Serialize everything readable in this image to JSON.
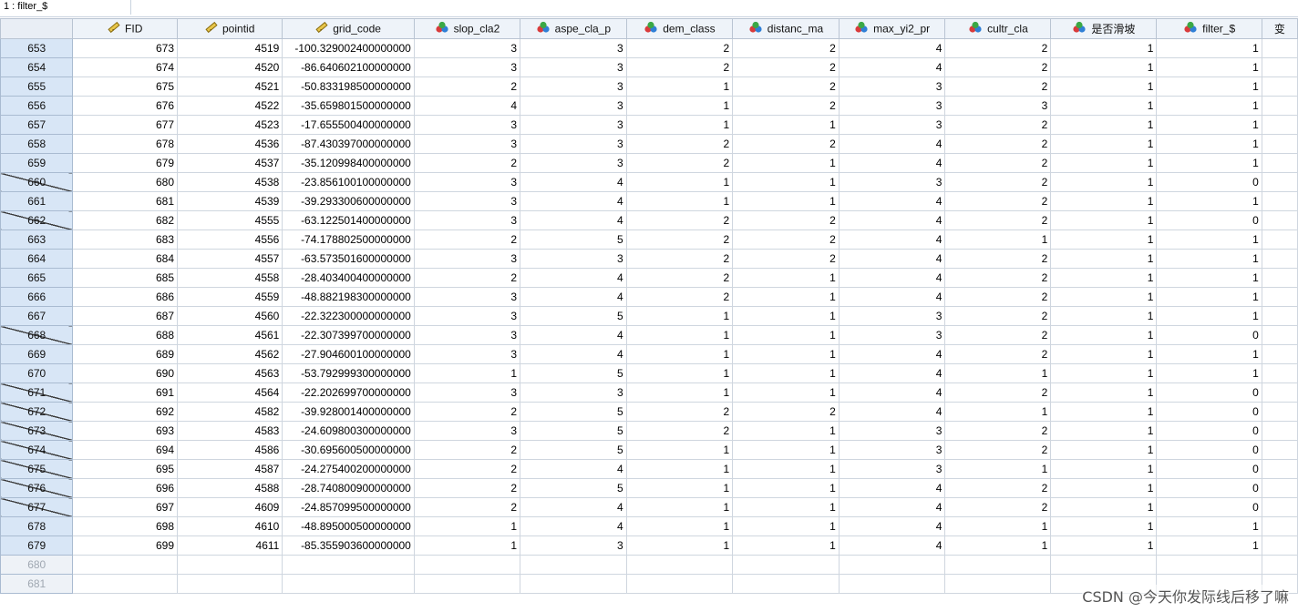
{
  "cell_reference": "1 : filter_$",
  "columns": [
    {
      "name": "FID",
      "icon": "ruler-icon"
    },
    {
      "name": "pointid",
      "icon": "ruler-icon"
    },
    {
      "name": "grid_code",
      "icon": "ruler-icon"
    },
    {
      "name": "slop_cla2",
      "icon": "nominal-icon"
    },
    {
      "name": "aspe_cla_p",
      "icon": "nominal-icon"
    },
    {
      "name": "dem_class",
      "icon": "nominal-icon"
    },
    {
      "name": "distanc_ma",
      "icon": "nominal-icon"
    },
    {
      "name": "max_yi2_pr",
      "icon": "nominal-icon"
    },
    {
      "name": "cultr_cla",
      "icon": "nominal-icon"
    },
    {
      "name": "是否滑坡",
      "icon": "nominal-icon"
    },
    {
      "name": "filter_$",
      "icon": "nominal-icon"
    },
    {
      "name": "变",
      "icon": ""
    }
  ],
  "rows": [
    {
      "n": "653",
      "f": false,
      "v": [
        "673",
        "4519",
        "-100.329002400000000",
        "3",
        "3",
        "2",
        "2",
        "4",
        "2",
        "1",
        "1"
      ]
    },
    {
      "n": "654",
      "f": false,
      "v": [
        "674",
        "4520",
        "-86.640602100000000",
        "3",
        "3",
        "2",
        "2",
        "4",
        "2",
        "1",
        "1"
      ]
    },
    {
      "n": "655",
      "f": false,
      "v": [
        "675",
        "4521",
        "-50.833198500000000",
        "2",
        "3",
        "1",
        "2",
        "3",
        "2",
        "1",
        "1"
      ]
    },
    {
      "n": "656",
      "f": false,
      "v": [
        "676",
        "4522",
        "-35.659801500000000",
        "4",
        "3",
        "1",
        "2",
        "3",
        "3",
        "1",
        "1"
      ]
    },
    {
      "n": "657",
      "f": false,
      "v": [
        "677",
        "4523",
        "-17.655500400000000",
        "3",
        "3",
        "1",
        "1",
        "3",
        "2",
        "1",
        "1"
      ]
    },
    {
      "n": "658",
      "f": false,
      "v": [
        "678",
        "4536",
        "-87.430397000000000",
        "3",
        "3",
        "2",
        "2",
        "4",
        "2",
        "1",
        "1"
      ]
    },
    {
      "n": "659",
      "f": false,
      "v": [
        "679",
        "4537",
        "-35.120998400000000",
        "2",
        "3",
        "2",
        "1",
        "4",
        "2",
        "1",
        "1"
      ]
    },
    {
      "n": "660",
      "f": true,
      "v": [
        "680",
        "4538",
        "-23.856100100000000",
        "3",
        "4",
        "1",
        "1",
        "3",
        "2",
        "1",
        "0"
      ]
    },
    {
      "n": "661",
      "f": false,
      "v": [
        "681",
        "4539",
        "-39.293300600000000",
        "3",
        "4",
        "1",
        "1",
        "4",
        "2",
        "1",
        "1"
      ]
    },
    {
      "n": "662",
      "f": true,
      "v": [
        "682",
        "4555",
        "-63.122501400000000",
        "3",
        "4",
        "2",
        "2",
        "4",
        "2",
        "1",
        "0"
      ]
    },
    {
      "n": "663",
      "f": false,
      "v": [
        "683",
        "4556",
        "-74.178802500000000",
        "2",
        "5",
        "2",
        "2",
        "4",
        "1",
        "1",
        "1"
      ]
    },
    {
      "n": "664",
      "f": false,
      "v": [
        "684",
        "4557",
        "-63.573501600000000",
        "3",
        "3",
        "2",
        "2",
        "4",
        "2",
        "1",
        "1"
      ]
    },
    {
      "n": "665",
      "f": false,
      "v": [
        "685",
        "4558",
        "-28.403400400000000",
        "2",
        "4",
        "2",
        "1",
        "4",
        "2",
        "1",
        "1"
      ]
    },
    {
      "n": "666",
      "f": false,
      "v": [
        "686",
        "4559",
        "-48.882198300000000",
        "3",
        "4",
        "2",
        "1",
        "4",
        "2",
        "1",
        "1"
      ]
    },
    {
      "n": "667",
      "f": false,
      "v": [
        "687",
        "4560",
        "-22.322300000000000",
        "3",
        "5",
        "1",
        "1",
        "3",
        "2",
        "1",
        "1"
      ]
    },
    {
      "n": "668",
      "f": true,
      "v": [
        "688",
        "4561",
        "-22.307399700000000",
        "3",
        "4",
        "1",
        "1",
        "3",
        "2",
        "1",
        "0"
      ]
    },
    {
      "n": "669",
      "f": false,
      "v": [
        "689",
        "4562",
        "-27.904600100000000",
        "3",
        "4",
        "1",
        "1",
        "4",
        "2",
        "1",
        "1"
      ]
    },
    {
      "n": "670",
      "f": false,
      "v": [
        "690",
        "4563",
        "-53.792999300000000",
        "1",
        "5",
        "1",
        "1",
        "4",
        "1",
        "1",
        "1"
      ]
    },
    {
      "n": "671",
      "f": true,
      "v": [
        "691",
        "4564",
        "-22.202699700000000",
        "3",
        "3",
        "1",
        "1",
        "4",
        "2",
        "1",
        "0"
      ]
    },
    {
      "n": "672",
      "f": true,
      "v": [
        "692",
        "4582",
        "-39.928001400000000",
        "2",
        "5",
        "2",
        "2",
        "4",
        "1",
        "1",
        "0"
      ]
    },
    {
      "n": "673",
      "f": true,
      "v": [
        "693",
        "4583",
        "-24.609800300000000",
        "3",
        "5",
        "2",
        "1",
        "3",
        "2",
        "1",
        "0"
      ]
    },
    {
      "n": "674",
      "f": true,
      "v": [
        "694",
        "4586",
        "-30.695600500000000",
        "2",
        "5",
        "1",
        "1",
        "3",
        "2",
        "1",
        "0"
      ]
    },
    {
      "n": "675",
      "f": true,
      "v": [
        "695",
        "4587",
        "-24.275400200000000",
        "2",
        "4",
        "1",
        "1",
        "3",
        "1",
        "1",
        "0"
      ]
    },
    {
      "n": "676",
      "f": true,
      "v": [
        "696",
        "4588",
        "-28.740800900000000",
        "2",
        "5",
        "1",
        "1",
        "4",
        "2",
        "1",
        "0"
      ]
    },
    {
      "n": "677",
      "f": true,
      "v": [
        "697",
        "4609",
        "-24.857099500000000",
        "2",
        "4",
        "1",
        "1",
        "4",
        "2",
        "1",
        "0"
      ]
    },
    {
      "n": "678",
      "f": false,
      "v": [
        "698",
        "4610",
        "-48.895000500000000",
        "1",
        "4",
        "1",
        "1",
        "4",
        "1",
        "1",
        "1"
      ]
    },
    {
      "n": "679",
      "f": false,
      "v": [
        "699",
        "4611",
        "-85.355903600000000",
        "1",
        "3",
        "1",
        "1",
        "4",
        "1",
        "1",
        "1"
      ]
    }
  ],
  "empty_rows": [
    "680",
    "681"
  ],
  "watermark": "CSDN @今天你发际线后移了嘛"
}
